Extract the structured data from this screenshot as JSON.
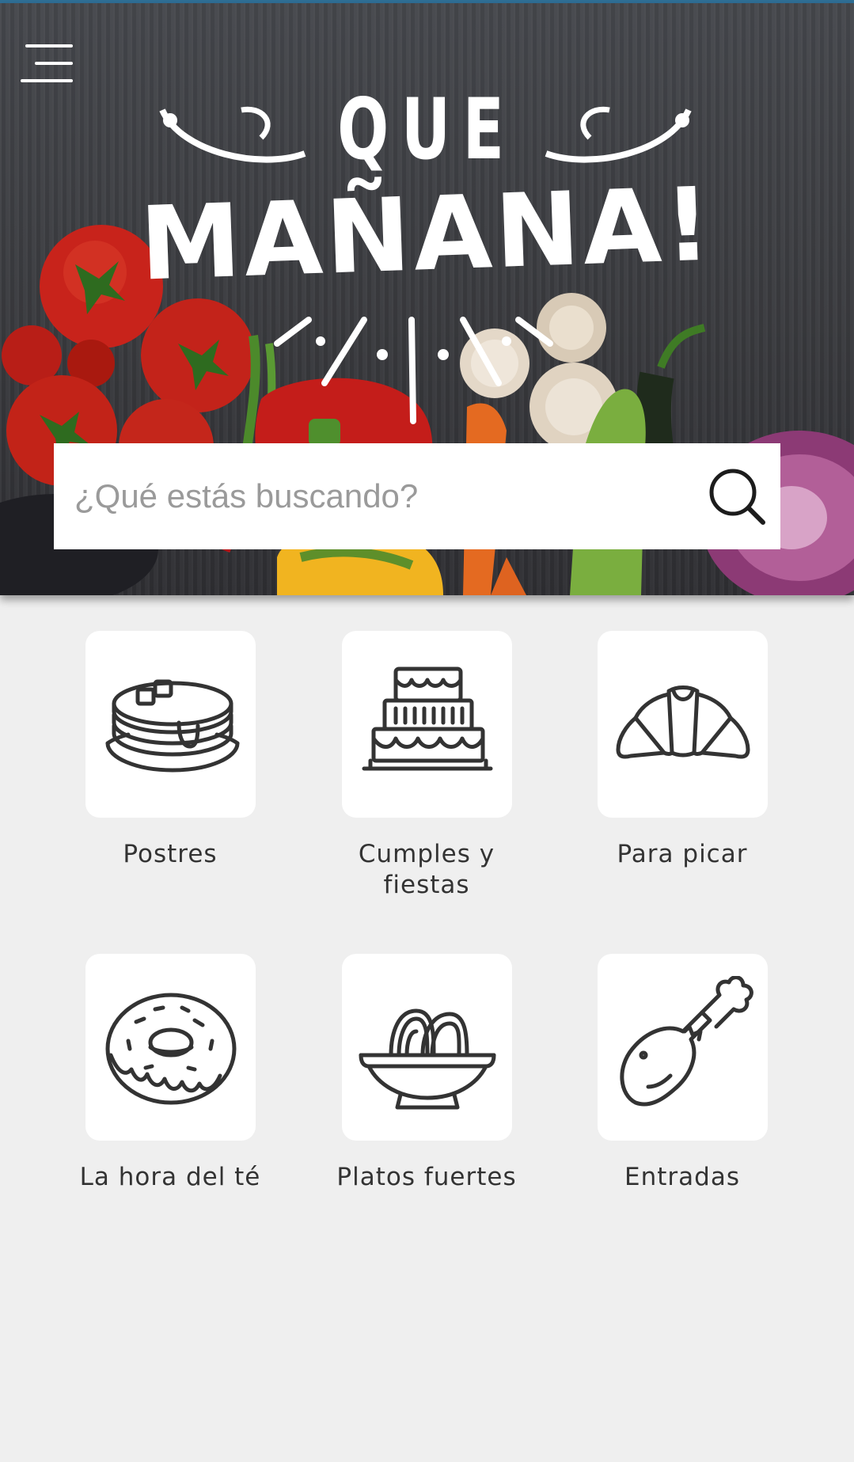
{
  "header": {
    "logo_line1": "QUE",
    "logo_line2": "MAÑANA!",
    "menu_icon": "hamburger-menu-icon"
  },
  "search": {
    "placeholder": "¿Qué estás buscando?",
    "value": "",
    "icon": "search-icon"
  },
  "categories": [
    {
      "label": "Postres",
      "icon": "pancakes-icon"
    },
    {
      "label": "Cumples y fiestas",
      "icon": "cake-icon"
    },
    {
      "label": "Para picar",
      "icon": "croissant-icon"
    },
    {
      "label": "La hora del té",
      "icon": "donut-icon"
    },
    {
      "label": "Platos fuertes",
      "icon": "pasta-bowl-icon"
    },
    {
      "label": "Entradas",
      "icon": "chicken-leg-icon"
    }
  ],
  "colors": {
    "accent": "#2f6f96",
    "background": "#efefef",
    "icon_stroke": "#333333"
  }
}
